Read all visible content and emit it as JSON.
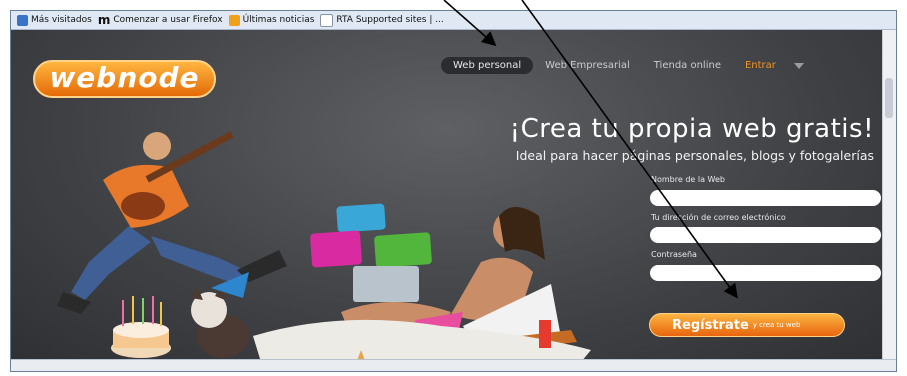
{
  "bookmarks": [
    {
      "label": "Más visitados",
      "icon": "bookmark-icon"
    },
    {
      "label": "Comenzar a usar Firefox",
      "icon": "m-logo-icon"
    },
    {
      "label": "Últimas noticias",
      "icon": "rss-icon"
    },
    {
      "label": "RTA Supported sites | ...",
      "icon": "page-icon"
    }
  ],
  "logo": {
    "text": "webnode"
  },
  "nav": {
    "items": [
      "Web personal",
      "Web Empresarial",
      "Tienda online"
    ],
    "active": "Web personal",
    "login": "Entrar"
  },
  "hero": {
    "headline": "¡Crea tu propia web gratis!",
    "subheadline": "Ideal para hacer páginas personales, blogs y fotogalerías"
  },
  "form": {
    "fields": [
      {
        "label": "Nombre de la Web",
        "value": ""
      },
      {
        "label": "Tu dirección de correo electrónico",
        "value": ""
      },
      {
        "label": "Contraseña",
        "value": ""
      }
    ],
    "submit": {
      "main": "Regístrate",
      "small": "y crea tu web"
    }
  },
  "colors": {
    "accent": "#f39321",
    "background": "#3f4145"
  }
}
